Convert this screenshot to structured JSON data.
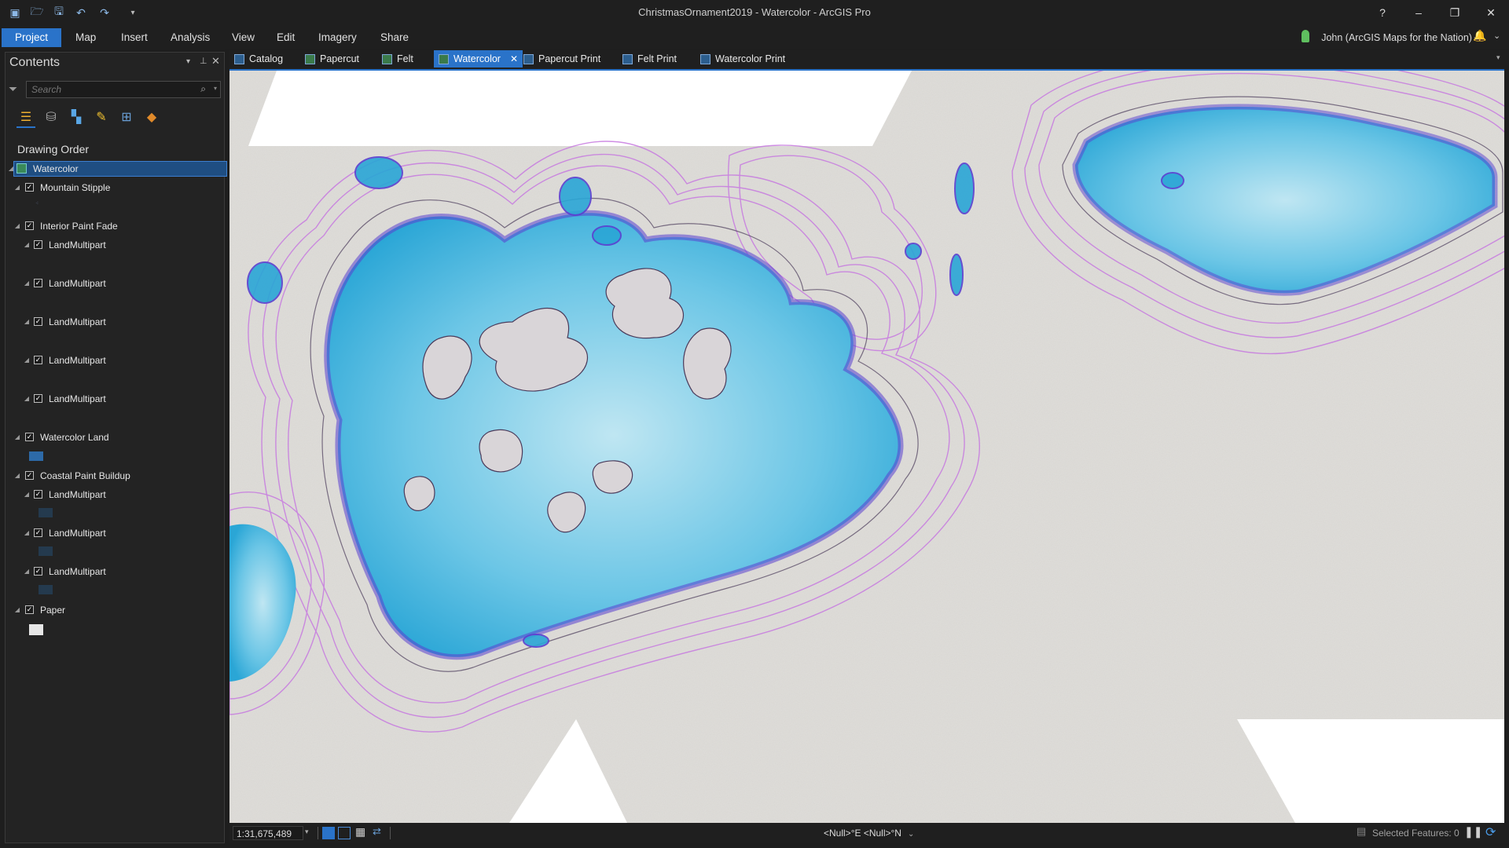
{
  "window": {
    "title": "ChristmasOrnament2019 - Watercolor - ArcGIS Pro",
    "help": "?",
    "minimize": "–",
    "restore": "❐",
    "close": "✕"
  },
  "ribbon": {
    "tabs": [
      "Project",
      "Map",
      "Insert",
      "Analysis",
      "View",
      "Edit",
      "Imagery",
      "Share"
    ],
    "active": "Project",
    "user": "John (ArcGIS Maps for the Nation)"
  },
  "contents": {
    "title": "Contents",
    "search_placeholder": "Search",
    "section": "Drawing Order",
    "layers": [
      {
        "label": "Watercolor",
        "depth": 0,
        "type": "map",
        "selected": true
      },
      {
        "label": "Mountain Stipple",
        "depth": 1,
        "checked": true
      },
      {
        "label": "Interior Paint Fade",
        "depth": 1,
        "checked": true
      },
      {
        "label": "LandMultipart",
        "depth": 2,
        "checked": true
      },
      {
        "label": "LandMultipart",
        "depth": 2,
        "checked": true
      },
      {
        "label": "LandMultipart",
        "depth": 2,
        "checked": true
      },
      {
        "label": "LandMultipart",
        "depth": 2,
        "checked": true
      },
      {
        "label": "LandMultipart",
        "depth": 2,
        "checked": true
      },
      {
        "label": "Watercolor Land",
        "depth": 1,
        "checked": true
      },
      {
        "label": "Coastal Paint Buildup",
        "depth": 1,
        "checked": true
      },
      {
        "label": "LandMultipart",
        "depth": 2,
        "checked": true
      },
      {
        "label": "LandMultipart",
        "depth": 2,
        "checked": true
      },
      {
        "label": "LandMultipart",
        "depth": 2,
        "checked": true
      },
      {
        "label": "Paper",
        "depth": 1,
        "checked": true
      }
    ]
  },
  "map_tabs": {
    "tabs": [
      "Catalog",
      "Papercut",
      "Felt",
      "Watercolor",
      "Papercut Print",
      "Felt Print",
      "Watercolor Print"
    ],
    "active": "Watercolor"
  },
  "status": {
    "scale": "1:31,675,489",
    "coordinates": "<Null>°E <Null>°N",
    "selected": "Selected Features: 0"
  },
  "colors": {
    "accent": "#2a73c9",
    "water": "#2bb0d8",
    "deep_water": "#5a3fd0",
    "contour": "#c77ae0",
    "paper": "#d9d7d3"
  }
}
